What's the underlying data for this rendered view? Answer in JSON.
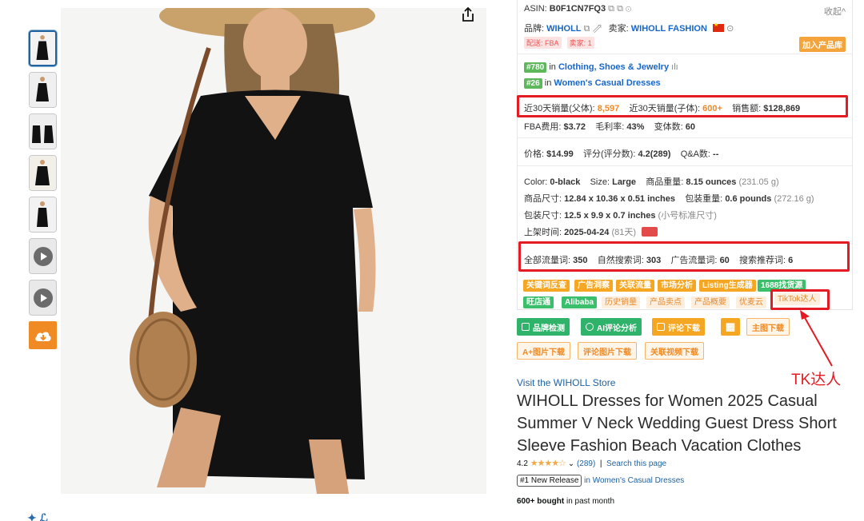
{
  "panel": {
    "asin_label": "ASIN:",
    "asin": "B0F1CN7FQ3",
    "collapse": "收起^",
    "brand_label": "品牌:",
    "brand": "WIHOLL",
    "seller_label": "卖家:",
    "seller": "WIHOLL FASHION",
    "ship_tag": "配送: FBA",
    "seller_count_tag": "卖家: 1",
    "add_product": "加入产品库",
    "rank1": "#780",
    "rank1_in": "in",
    "rank1_cat": "Clothing, Shoes & Jewelry",
    "rank2": "#26",
    "rank2_in": "in",
    "rank2_cat": "Women's Casual Dresses",
    "sales_parent_label": "近30天销量(父体):",
    "sales_parent": "8,597",
    "sales_child_label": "近30天销量(子体):",
    "sales_child": "600+",
    "revenue_label": "销售额:",
    "revenue": "$128,869",
    "fba_label": "FBA费用:",
    "fba": "$3.72",
    "margin_label": "毛利率:",
    "margin": "43%",
    "variants_label": "变体数:",
    "variants": "60",
    "price_label": "价格:",
    "price": "$14.99",
    "rating_label": "评分(评分数):",
    "rating": "4.2(289)",
    "qa_label": "Q&A数:",
    "qa": "--",
    "color_label": "Color:",
    "color": "0-black",
    "size_label": "Size:",
    "size": "Large",
    "weight_label": "商品重量:",
    "weight": "8.15 ounces",
    "weight_g": "(231.05 g)",
    "dims_label": "商品尺寸:",
    "dims": "12.84 x 10.36 x 0.51 inches",
    "pkg_weight_label": "包装重量:",
    "pkg_weight": "0.6 pounds",
    "pkg_weight_g": "(272.16 g)",
    "pkg_dims_label": "包装尺寸:",
    "pkg_dims": "12.5 x 9.9 x 0.7 inches",
    "pkg_dims_note": "(小号标准尺寸)",
    "listed_label": "上架时间:",
    "listed": "2025-04-24",
    "listed_days": "(81天)",
    "kw_all_label": "全部流量词:",
    "kw_all": "350",
    "kw_natural_label": "自然搜索词:",
    "kw_natural": "303",
    "kw_ad_label": "广告流量词:",
    "kw_ad": "60",
    "kw_rec_label": "搜索推荐词:",
    "kw_rec": "6"
  },
  "chips": {
    "keyword_reverse": "关键词反查",
    "ad_insight": "广告洞察",
    "related_traffic": "关联流量",
    "market_analysis": "市场分析",
    "listing_gen": "Listing生成器",
    "source_1688": "1688找货源",
    "wangdiantong": "旺店通",
    "alibaba": "Alibaba",
    "history_sales": "历史销量",
    "product_points": "产品卖点",
    "product_overview": "产品概要",
    "youmaiyun": "优麦云",
    "tiktok": "TikTok达人"
  },
  "buttons": {
    "brand_check": "品牌检测",
    "ai_review": "AI评论分析",
    "review_download": "评论下载",
    "main_img_download": "主图下载",
    "aplus_download": "A+图片下载",
    "review_img_download": "评论图片下载",
    "video_download": "关联视频下载"
  },
  "annotation": {
    "tk_label": "TK达人"
  },
  "product": {
    "store_link": "Visit the WIHOLL Store",
    "title": "WIHOLL Dresses for Women 2025 Casual Summer V Neck Wedding Guest Dress Short Sleeve Fashion Beach Vacation Clothes",
    "rating_value": "4.2",
    "stars": "★★★★☆",
    "rating_count": "(289)",
    "divider": "|",
    "search_page": "Search this page",
    "new_release": "#1 New Release",
    "new_release_cat": "in Women's Casual Dresses",
    "bought_count": "600+ bought",
    "bought_period": "in past month"
  },
  "colors": {
    "accent_red": "#e41b23",
    "link_blue": "#2162a1",
    "plugin_orange": "#f08a24",
    "plugin_green": "#2fb36a"
  }
}
